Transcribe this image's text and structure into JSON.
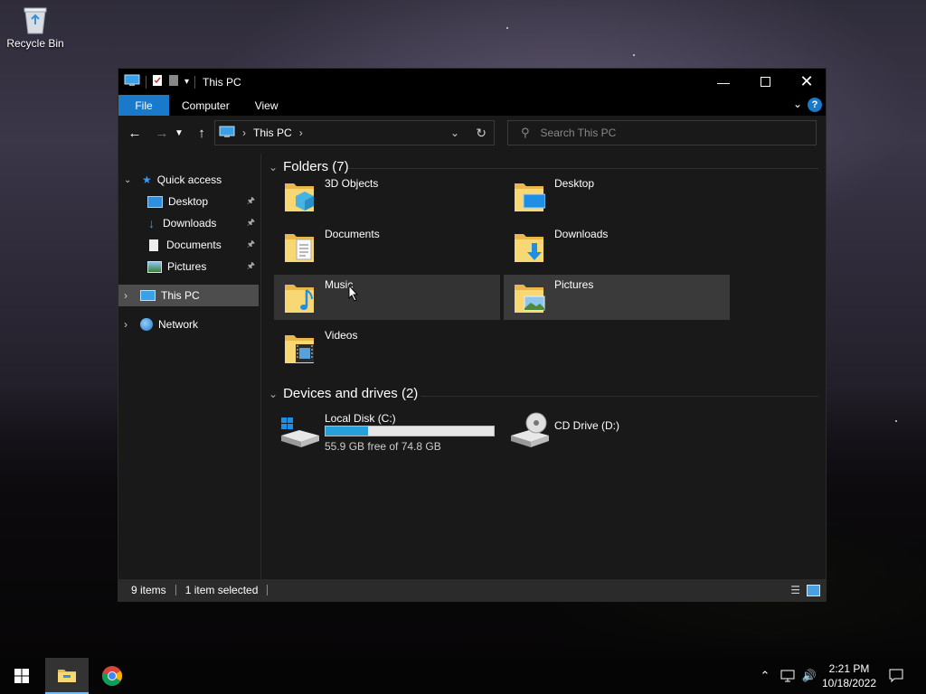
{
  "desktop": {
    "recycle_bin_label": "Recycle Bin"
  },
  "window": {
    "title": "This PC",
    "ribbon_tabs": [
      "File",
      "Computer",
      "View"
    ],
    "help_glyph": "?",
    "address_location": "This PC",
    "search_placeholder": "Search This PC",
    "accent_color": "#1979ca"
  },
  "sidebar": {
    "quick_access": "Quick access",
    "pinned": [
      {
        "label": "Desktop",
        "icon": "desktop-icon"
      },
      {
        "label": "Downloads",
        "icon": "downloads-icon"
      },
      {
        "label": "Documents",
        "icon": "documents-icon"
      },
      {
        "label": "Pictures",
        "icon": "pictures-icon"
      }
    ],
    "this_pc": "This PC",
    "network": "Network"
  },
  "content": {
    "folders_header": "Folders (7)",
    "folders": [
      {
        "label": "3D Objects"
      },
      {
        "label": "Desktop"
      },
      {
        "label": "Documents"
      },
      {
        "label": "Downloads"
      },
      {
        "label": "Music"
      },
      {
        "label": "Pictures"
      },
      {
        "label": "Videos"
      }
    ],
    "drives_header": "Devices and drives (2)",
    "drives": [
      {
        "label": "Local Disk (C:)",
        "free_text": "55.9 GB free of 74.8 GB",
        "used_fraction": 0.253
      },
      {
        "label": "CD Drive (D:)"
      }
    ]
  },
  "statusbar": {
    "items_count": "9 items",
    "selected_text": "1 item selected"
  },
  "taskbar": {
    "time": "2:21 PM",
    "date": "10/18/2022"
  }
}
